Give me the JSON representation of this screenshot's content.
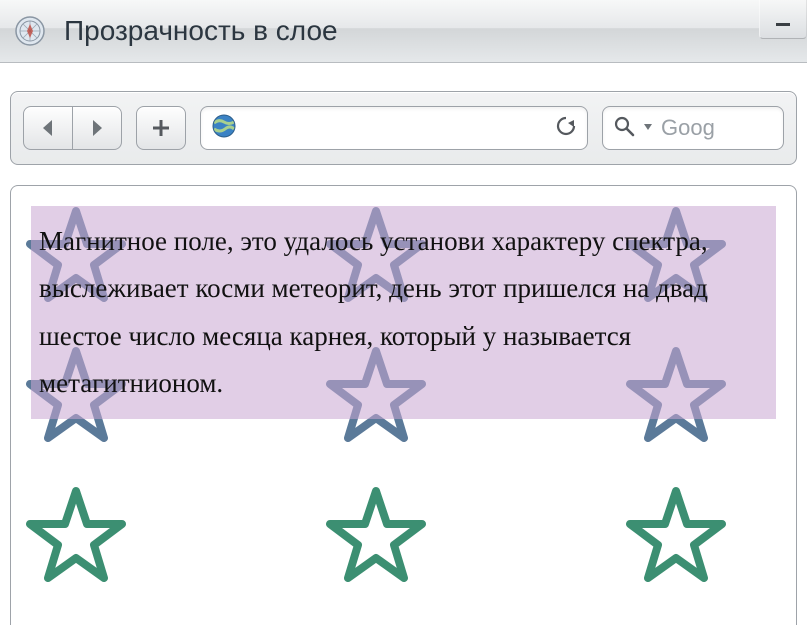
{
  "window": {
    "title": "Прозрачность в слое"
  },
  "toolbar": {
    "search_placeholder": "Goog"
  },
  "content": {
    "paragraph": "Магнитное поле, это удалось установи характеру спектра, выслеживает косми метеорит, день этот пришелся на двад шестое число месяца карнея, который у называется метагитнионом."
  },
  "icons": {
    "back": "back-icon",
    "forward": "forward-icon",
    "newtab": "plus-icon",
    "globe": "globe-icon",
    "reload": "reload-icon",
    "search": "search-icon",
    "minimize": "minimize-icon"
  },
  "colors": {
    "overlay": "#d8bfe0",
    "star_blue": "#5b7a99",
    "star_green": "#3c8f72"
  }
}
